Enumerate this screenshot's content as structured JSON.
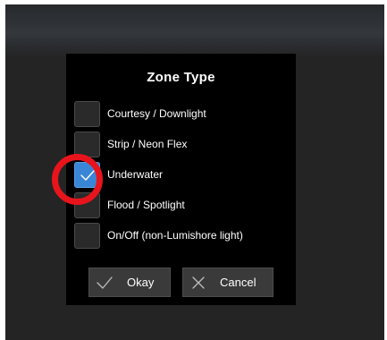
{
  "dialog": {
    "title": "Zone Type",
    "options": [
      {
        "label": "Courtesy / Downlight",
        "checked": false
      },
      {
        "label": "Strip / Neon Flex",
        "checked": false
      },
      {
        "label": "Underwater",
        "checked": true
      },
      {
        "label": "Flood / Spotlight",
        "checked": false
      },
      {
        "label": "On/Off (non-Lumishore light)",
        "checked": false
      }
    ],
    "okay_label": "Okay",
    "cancel_label": "Cancel"
  },
  "icons": {
    "checkbox_checked": "checkmark-icon",
    "okay": "checkmark-icon",
    "cancel": "close-icon"
  },
  "colors": {
    "checkbox_checked": "#3a86d6",
    "annotation": "#e8141c",
    "dialog_background": "#000000"
  }
}
